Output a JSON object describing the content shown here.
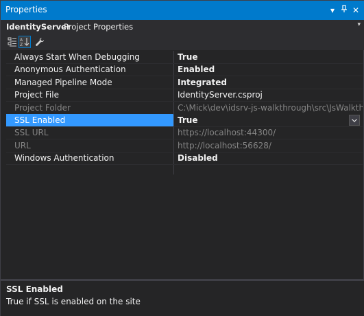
{
  "window": {
    "title": "Properties"
  },
  "titlebar": {
    "dropdown_glyph": "▾",
    "pin_glyph": "ᵽ",
    "close_glyph": "✕"
  },
  "objectbar": {
    "object_name": "IdentityServer",
    "object_type": "Project Properties",
    "dropdown_glyph": "▾"
  },
  "toolbar": {
    "icons": [
      "categorized-icon",
      "alphabetical-icon",
      "property-pages-icon"
    ],
    "active": "alphabetical-icon"
  },
  "properties": [
    {
      "name": "Always Start When Debugging",
      "value": "True",
      "bold": true,
      "gray": false
    },
    {
      "name": "Anonymous Authentication",
      "value": "Enabled",
      "bold": true,
      "gray": false
    },
    {
      "name": "Managed Pipeline Mode",
      "value": "Integrated",
      "bold": true,
      "gray": false
    },
    {
      "name": "Project File",
      "value": "IdentityServer.csproj",
      "bold": false,
      "gray": false
    },
    {
      "name": "Project Folder",
      "value": "C:\\Mick\\dev\\idsrv-js-walkthrough\\src\\JsWalkthrough",
      "bold": false,
      "gray": true
    },
    {
      "name": "SSL Enabled",
      "value": "True",
      "bold": true,
      "gray": false,
      "selected": true
    },
    {
      "name": "SSL URL",
      "value": "https://localhost:44300/",
      "bold": false,
      "gray": true
    },
    {
      "name": "URL",
      "value": "http://localhost:56628/",
      "bold": false,
      "gray": true
    },
    {
      "name": "Windows Authentication",
      "value": "Disabled",
      "bold": true,
      "gray": false
    }
  ],
  "description": {
    "title": "SSL Enabled",
    "text": "True if SSL is enabled on the site"
  },
  "colors": {
    "accent": "#007acc",
    "selection": "#3399ff",
    "background": "#252526"
  }
}
